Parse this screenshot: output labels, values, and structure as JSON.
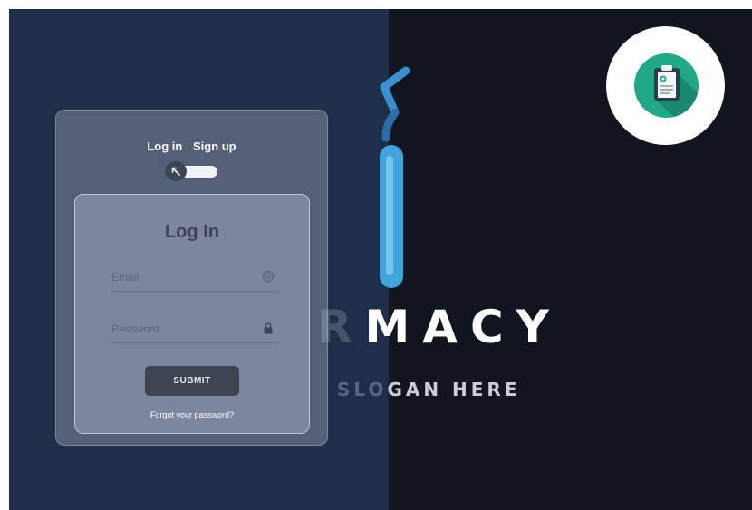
{
  "brand": {
    "name_faded": "R",
    "name_main": "MACY",
    "slogan_faded": "SLO",
    "slogan_main": "GAN HERE",
    "logo_icon": "clipboard-icon"
  },
  "auth": {
    "tabs": {
      "login": "Log in",
      "signup": "Sign up"
    },
    "toggle_icon": "arrow-up-left-icon"
  },
  "login_form": {
    "title": "Log In",
    "email_placeholder": "Email",
    "email_icon": "at-sign-icon",
    "password_placeholder": "Password",
    "password_icon": "lock-icon",
    "submit_label": "SUBMIT",
    "forgot_label": "Forgot your password?"
  },
  "colors": {
    "left_bg": "#1f2f4a",
    "right_bg": "#111520",
    "logo_green": "#1fa987",
    "tube_blue": "#3fa3dc"
  }
}
